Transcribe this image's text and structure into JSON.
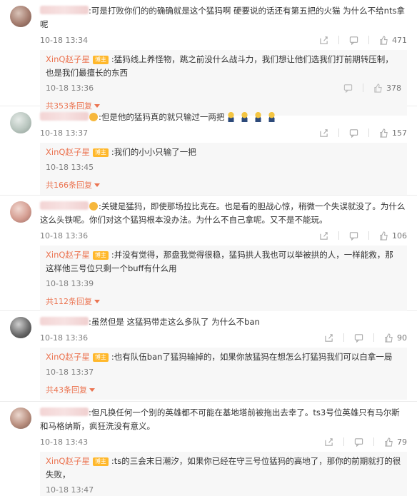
{
  "comments": [
    {
      "text": ":可是打败你们的的确确就是这个猛犸啊 硬要说的话还有第五把的火猫 为什么不给nts拿呢",
      "time": "10-18 13:34",
      "likes": "471",
      "reply": {
        "author": "XinQ赵子星",
        "badge": "博主",
        "text": ":猛犸线上养怪物，跳之前没什么战斗力，我们想让他们选我们打前期转压制，也是我们最擅长的东西",
        "time": "10-18 13:36",
        "likes": "378"
      },
      "more": "共353条回复"
    },
    {
      "text_suffix": ":但是他的猛犸真的就只输过一两把",
      "time": "10-18 13:37",
      "likes": "157",
      "reply": {
        "author": "XinQ赵子星",
        "badge": "博主",
        "text": ":我们的小小只输了一把",
        "time": "10-18 13:45"
      },
      "more": "共166条回复"
    },
    {
      "text_suffix": ":关键是猛犸，即使那场拉比克在。也是看的胆战心惊，稍微一个失误就没了。为什么这么头铁呢。你们对这个猛犸根本没办法。为什么不自己拿呢。又不是不能玩。",
      "time": "10-18 13:36",
      "likes": "106",
      "reply": {
        "author": "XinQ赵子星",
        "badge": "博主",
        "text": ":并没有觉得，那盘我觉得很稳，猛犸拱人我也可以举被拱的人，一样能救，那这样他三号位只剩一个buff有什么用",
        "time": "10-18 13:39"
      },
      "more": "共112条回复"
    },
    {
      "text": ":虽然但是 这猛犸带走这么多队了 为什么不ban",
      "time": "10-18 13:36",
      "likes": "90",
      "reply": {
        "author": "XinQ赵子星",
        "badge": "博主",
        "text": ":也有队伍ban了猛犸输掉的，如果你放猛犸在想怎么打猛犸我们可以白拿一局",
        "time": "10-18 13:37"
      },
      "more": "共43条回复"
    },
    {
      "text": ":但凡换任何一个别的英雄都不可能在基地塔前被拖出去幸了。ts3号位英雄只有马尔斯和马格纳斯，疯狂洗没有意义。",
      "time": "10-18 13:43",
      "likes": "79",
      "reply": {
        "author": "XinQ赵子星",
        "badge": "博主",
        "text": ":ts的三会末日潮汐，如果你已经在守三号位猛犸的高地了，那你的前期就打的很失败，",
        "time": "10-18 13:47"
      }
    }
  ],
  "icons": {
    "share": "share-icon",
    "comment": "comment-icon",
    "like": "thumbs-up-icon",
    "more": "caret-down-icon"
  },
  "colors": {
    "accent": "#eb7350",
    "badge": "#ffb82b",
    "reply_bg": "#f7f7f7"
  }
}
